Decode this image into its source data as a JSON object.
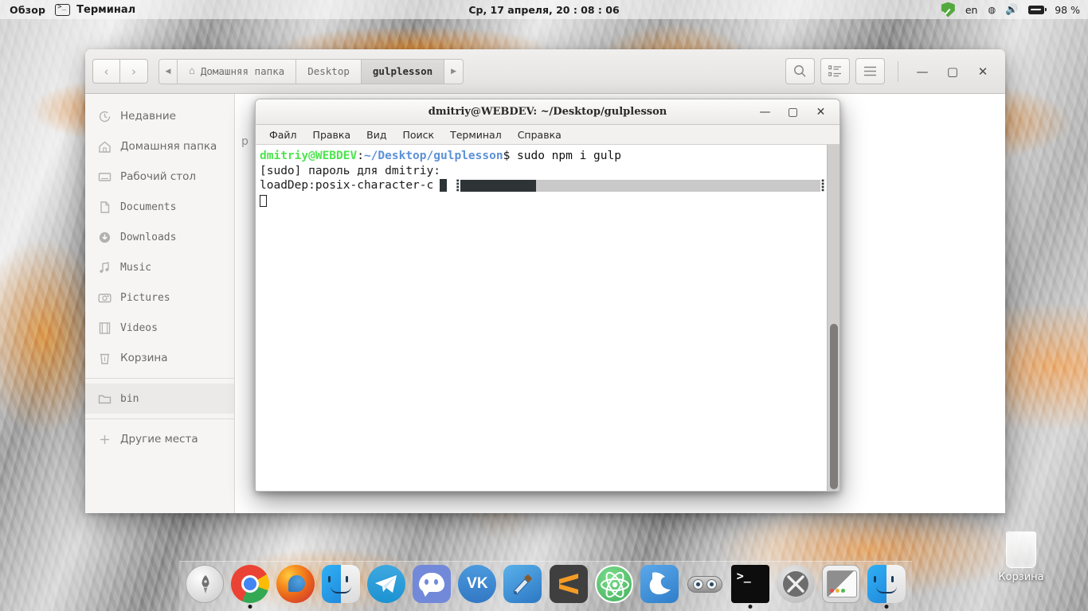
{
  "top_panel": {
    "overview_label": "Обзор",
    "app_icon": "terminal-icon",
    "app_name": "Терминал",
    "clock": "Ср, 17 апреля, 20 : 08 : 06",
    "shield_icon": "shield-check-icon",
    "language": "en",
    "eye_icon": "eye-icon",
    "volume_icon": "volume-icon",
    "battery_icon": "battery-icon",
    "battery_percent": "98 %"
  },
  "file_manager": {
    "nav": {
      "back": "‹",
      "forward": "›"
    },
    "breadcrumb": {
      "left_arrow": "◀",
      "right_arrow": "▶",
      "items": [
        {
          "label": "Домашняя папка",
          "icon": "home-icon",
          "active": false
        },
        {
          "label": "Desktop",
          "icon": "",
          "active": false
        },
        {
          "label": "gulplesson",
          "icon": "",
          "active": true
        }
      ]
    },
    "tools": [
      {
        "name": "search-icon"
      },
      {
        "name": "list-view-icon"
      },
      {
        "name": "hamburger-menu-icon"
      }
    ],
    "window_buttons": [
      {
        "name": "minimize-button",
        "glyph": "—"
      },
      {
        "name": "maximize-button",
        "glyph": "▢"
      },
      {
        "name": "close-button",
        "glyph": "✕"
      }
    ],
    "sidebar": {
      "groups": [
        [
          {
            "label": "Недавние",
            "icon": "recent-clock-icon",
            "cyr": true
          },
          {
            "label": "Домашняя папка",
            "icon": "home-icon",
            "cyr": true
          },
          {
            "label": "Рабочий стол",
            "icon": "desktop-icon",
            "cyr": true
          },
          {
            "label": "Documents",
            "icon": "documents-icon",
            "cyr": false
          },
          {
            "label": "Downloads",
            "icon": "downloads-icon",
            "cyr": false
          },
          {
            "label": "Music",
            "icon": "music-icon",
            "cyr": false
          },
          {
            "label": "Pictures",
            "icon": "pictures-icon",
            "cyr": false
          },
          {
            "label": "Videos",
            "icon": "videos-icon",
            "cyr": false
          },
          {
            "label": "Корзина",
            "icon": "trash-icon",
            "cyr": true
          }
        ],
        [
          {
            "label": "bin",
            "icon": "folder-icon",
            "cyr": false,
            "selected": true
          }
        ],
        [
          {
            "label": "Другие места",
            "icon": "plus-icon",
            "cyr": true
          }
        ]
      ]
    },
    "content": {
      "ghost_text": "р"
    }
  },
  "terminal": {
    "title": "dmitriy@WEBDEV: ~/Desktop/gulplesson",
    "window_buttons": [
      {
        "name": "minimize-button",
        "glyph": "—"
      },
      {
        "name": "maximize-button",
        "glyph": "▢"
      },
      {
        "name": "close-button",
        "glyph": "✕"
      }
    ],
    "menu": [
      "Файл",
      "Правка",
      "Вид",
      "Поиск",
      "Терминал",
      "Справка"
    ],
    "lines": {
      "prompt_user": "dmitriy@WEBDEV",
      "prompt_colon": ":",
      "prompt_path": "~/Desktop/gulplesson",
      "prompt_command": "$ sudo npm i gulp",
      "line2": "[sudo] пароль для dmitriy:",
      "line3_label": "loadDep:posix-character-c",
      "bar_left": "⢸",
      "bar_right": "⡇",
      "bar_percent": 21
    },
    "colors": {
      "green": "#4ee44e",
      "blue": "#5c91d6",
      "bar_fill": "#2e3436",
      "bar_track": "#c9c9c9"
    }
  },
  "desktop": {
    "trash_label": "Корзина",
    "trash_icon": "trash-icon"
  },
  "dock": {
    "items": [
      {
        "name": "launchpad-icon",
        "running": false
      },
      {
        "name": "google-chrome-icon",
        "running": true
      },
      {
        "name": "firefox-icon",
        "running": false
      },
      {
        "name": "finder-icon",
        "running": false
      },
      {
        "name": "telegram-icon",
        "running": false
      },
      {
        "name": "discord-icon",
        "running": false
      },
      {
        "name": "vk-icon",
        "running": false
      },
      {
        "name": "xcode-icon",
        "running": false
      },
      {
        "name": "sublime-text-icon",
        "running": false
      },
      {
        "name": "atom-icon",
        "running": false
      },
      {
        "name": "sketch-icon",
        "running": false
      },
      {
        "name": "github-desktop-icon",
        "running": false
      },
      {
        "name": "terminal-icon",
        "running": true
      },
      {
        "name": "xcode-tools-icon",
        "running": false
      },
      {
        "name": "preview-window-icon",
        "running": false
      },
      {
        "name": "finder-second-icon",
        "running": true
      }
    ]
  }
}
